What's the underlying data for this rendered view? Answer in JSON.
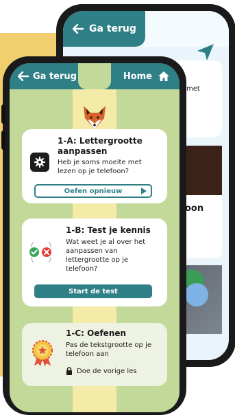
{
  "back_screen": {
    "back_label": "Ga terug",
    "partial_text_1": "met",
    "partial_text_2": "oon"
  },
  "header": {
    "back_label": "Ga terug",
    "home_label": "Home"
  },
  "lessons": [
    {
      "title": "1-A: Lettergrootte aanpassen",
      "description": "Heb je soms moeite met lezen op je telefoon?",
      "button_label": "Oefen opnieuw",
      "icon": "gear-icon"
    },
    {
      "title": "1-B: Test je kennis",
      "description": "Wat weet je al over het aanpassen van lettergrootte op je telefoon?",
      "button_label": "Start de test",
      "icon": "check-cross-icon"
    },
    {
      "title": "1-C: Oefenen",
      "description": "Pas de tekstgrootte op je telefoon aan",
      "lock_text": "Doe de vorige les",
      "icon": "award-badge-icon"
    }
  ],
  "colors": {
    "accent": "#2f7f86",
    "background": "#c3d99a",
    "path": "#f3eba7",
    "yellow": "#f2cf6e"
  }
}
